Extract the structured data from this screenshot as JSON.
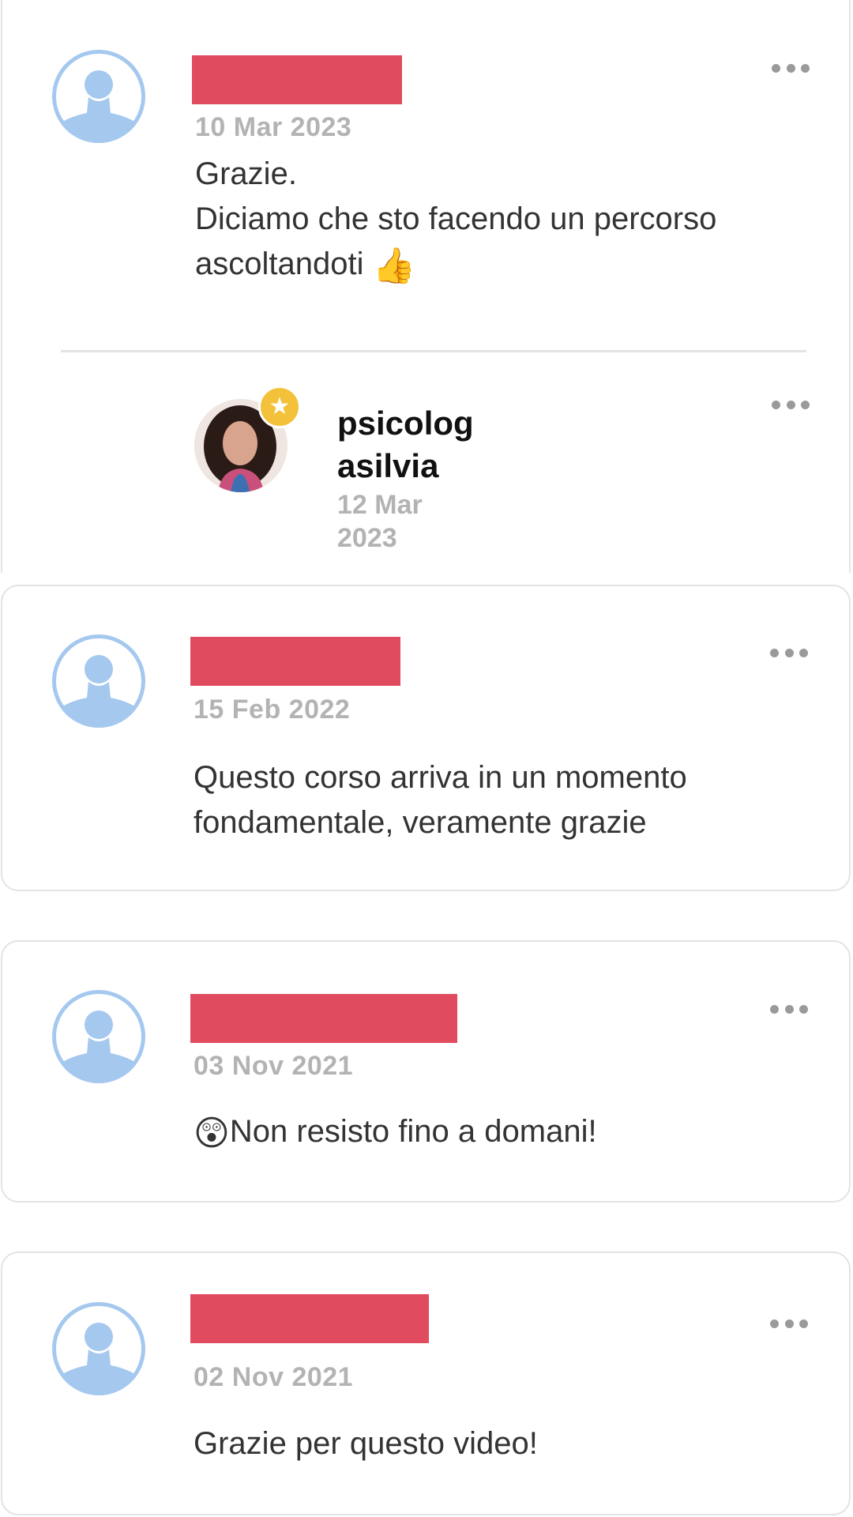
{
  "comments": [
    {
      "date": "10 Mar 2023",
      "text": "Grazie.\nDiciamo che sto facendo un percorso\nascoltandoti",
      "emoji": "👍",
      "reply": {
        "author": "psicolog\nasilvia",
        "date": "12 Mar\n2023"
      }
    },
    {
      "date": "15 Feb 2022",
      "text": "Questo corso arriva in un momento\nfondamentale, veramente grazie"
    },
    {
      "date": "03 Nov 2021",
      "emoji": "😲",
      "text": "Non resisto fino a domani!"
    },
    {
      "date": "02 Nov 2021",
      "text": "Grazie per questo video!"
    }
  ],
  "icons": {
    "avatar": "default-user-icon",
    "menu": "more-dots-icon",
    "badge": "star-icon"
  },
  "colors": {
    "redacted": "#e04b5f",
    "avatar": "#a5c8ef",
    "badge": "#f3c13a"
  }
}
